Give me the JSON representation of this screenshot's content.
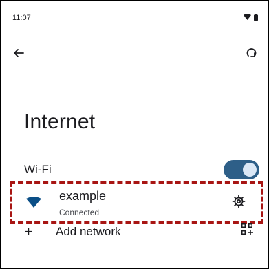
{
  "status_bar": {
    "time": "11:07",
    "icons": [
      "wifi-icon",
      "battery-icon"
    ]
  },
  "toolbar": {
    "back_icon": "back-arrow-icon",
    "refresh_icon": "refresh-icon"
  },
  "page": {
    "title": "Internet"
  },
  "wifi": {
    "label": "Wi-Fi",
    "enabled": true
  },
  "network": {
    "name": "example",
    "status": "Connected",
    "icon": "wifi-signal-icon",
    "settings_icon": "gear-icon",
    "highlight_color": "#a81513"
  },
  "add_network": {
    "label": "Add network",
    "icon": "plus-icon",
    "qr_icon": "qr-code-icon"
  },
  "colors": {
    "toggle_track": "#2e5f88",
    "toggle_thumb": "#dbe8f6",
    "wifi_icon": "#0b4f87"
  }
}
